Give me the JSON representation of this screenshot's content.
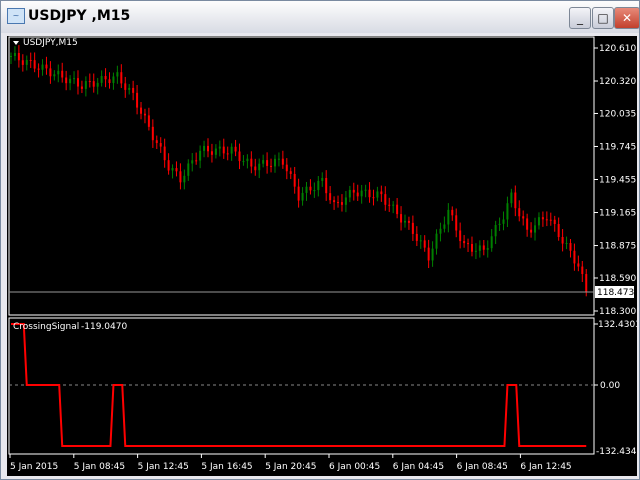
{
  "window": {
    "title": "USDJPY ,M15",
    "minimize": "_",
    "maximize": "□",
    "close": "✕"
  },
  "main_chart": {
    "label": "USDJPY,M15",
    "current_price": "118.473",
    "price_labels": [
      "120.610",
      "120.320",
      "120.035",
      "119.745",
      "119.455",
      "119.165",
      "118.875",
      "118.590",
      "118.300"
    ],
    "price_values": [
      120.61,
      120.32,
      120.035,
      119.745,
      119.455,
      119.165,
      118.875,
      118.59,
      118.3
    ],
    "close_keypoints": [
      [
        0,
        120.54
      ],
      [
        8,
        120.43
      ],
      [
        18,
        120.28
      ],
      [
        27,
        120.36
      ],
      [
        31,
        120.19
      ],
      [
        36,
        119.84
      ],
      [
        40,
        119.57
      ],
      [
        43,
        119.46
      ],
      [
        48,
        119.71
      ],
      [
        56,
        119.71
      ],
      [
        61,
        119.57
      ],
      [
        69,
        119.62
      ],
      [
        73,
        119.31
      ],
      [
        79,
        119.44
      ],
      [
        82,
        119.22
      ],
      [
        87,
        119.35
      ],
      [
        94,
        119.31
      ],
      [
        102,
        119.0
      ],
      [
        106,
        118.78
      ],
      [
        111,
        119.18
      ],
      [
        115,
        118.87
      ],
      [
        120,
        118.83
      ],
      [
        125,
        119.14
      ],
      [
        127,
        119.31
      ],
      [
        131,
        119.0
      ],
      [
        136,
        119.14
      ],
      [
        140,
        118.92
      ],
      [
        144,
        118.7
      ],
      [
        146,
        118.47
      ]
    ],
    "colors": {
      "bull": "#008000",
      "bear": "#ff0000"
    }
  },
  "indicator": {
    "name": "CrossingSignal",
    "value": "-119.0470",
    "max_label": "132.4303",
    "zero_label": "0.00",
    "min_label": "-132.4342",
    "signal_steps": [
      [
        0,
        132.43
      ],
      [
        4,
        0
      ],
      [
        13,
        -132.43
      ],
      [
        26,
        0
      ],
      [
        29,
        -132.43
      ],
      [
        126,
        0
      ],
      [
        129,
        -132.43
      ],
      [
        146,
        -132.43
      ]
    ],
    "color": "#ff0000"
  },
  "time_axis": [
    "5 Jan 2015",
    "5 Jan 08:45",
    "5 Jan 12:45",
    "5 Jan 16:45",
    "5 Jan 20:45",
    "6 Jan 00:45",
    "6 Jan 04:45",
    "6 Jan 08:45",
    "6 Jan 12:45"
  ]
}
